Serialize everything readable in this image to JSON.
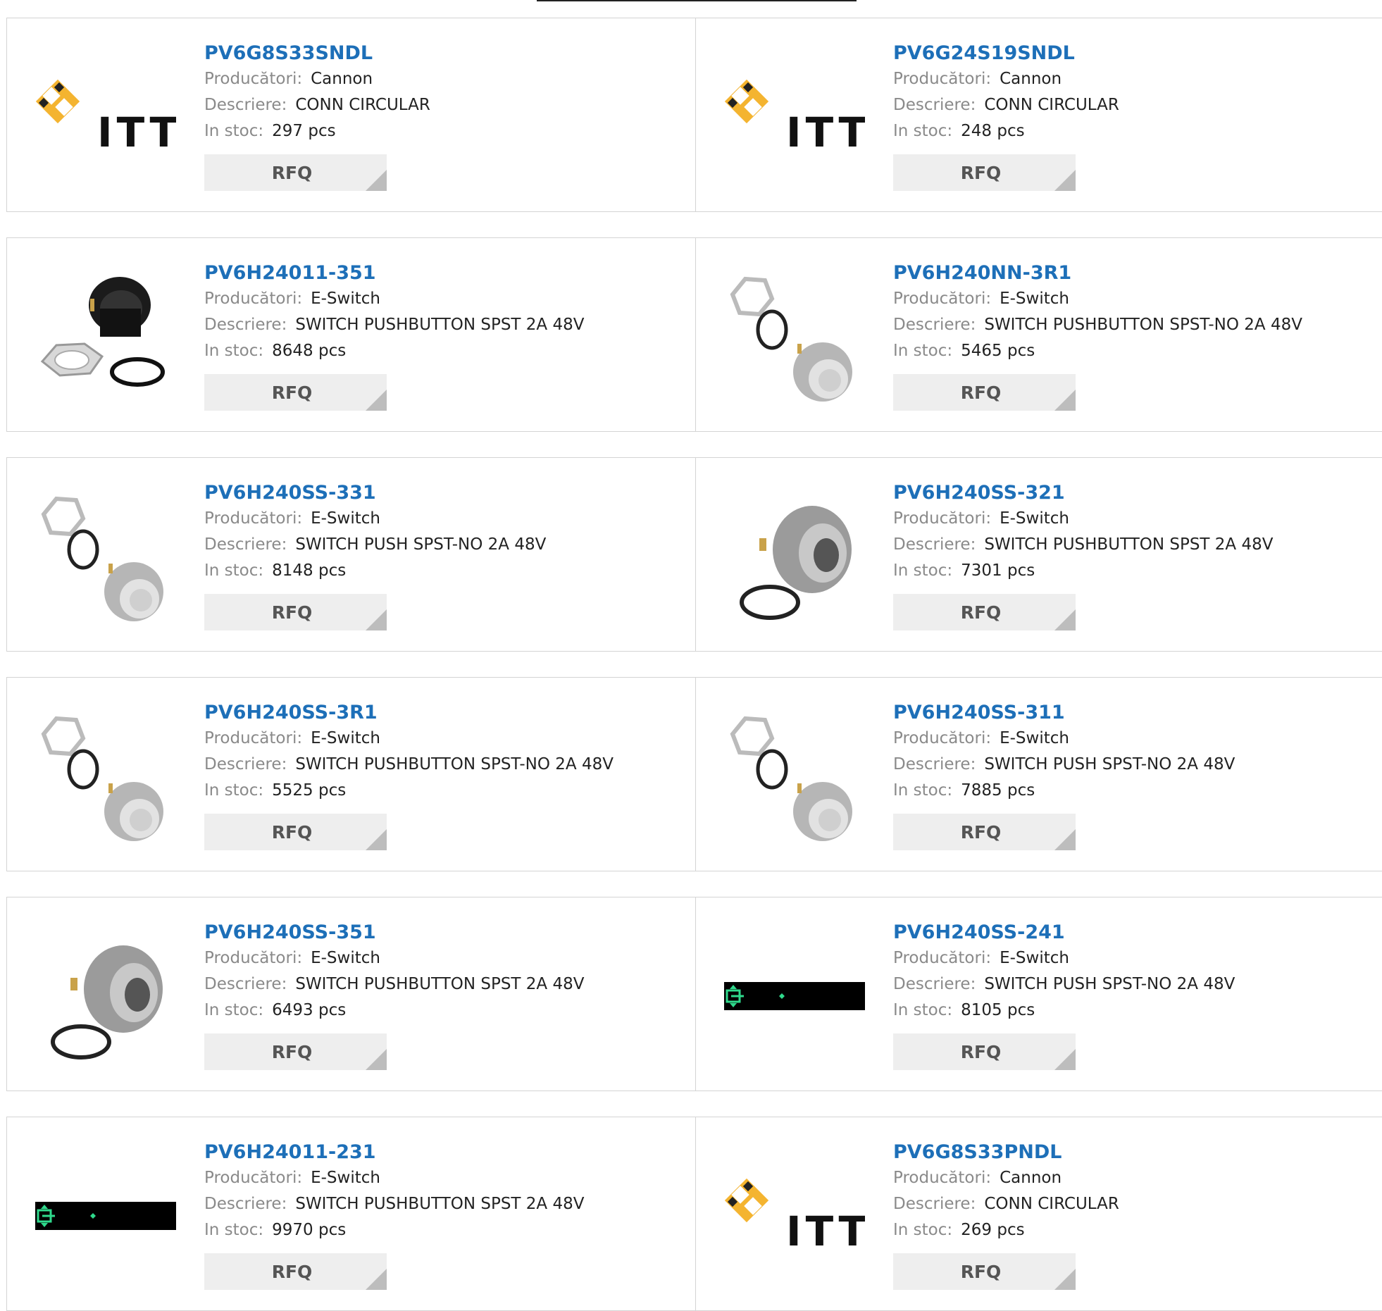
{
  "labels": {
    "manufacturer": "Producători:",
    "description": "Descriere:",
    "stock": "In stoc:",
    "rfq": "RFQ"
  },
  "products": [
    {
      "part": "PV6G8S33SNDL",
      "manufacturer": "Cannon",
      "description": "CONN CIRCULAR",
      "stock": "297 pcs",
      "image": "itt-logo"
    },
    {
      "part": "PV6G24S19SNDL",
      "manufacturer": "Cannon",
      "description": "CONN CIRCULAR",
      "stock": "248 pcs",
      "image": "itt-logo"
    },
    {
      "part": "PV6H24011-351",
      "manufacturer": "E-Switch",
      "description": "SWITCH PUSHBUTTON SPST 2A 48V",
      "stock": "8648 pcs",
      "image": "black-pushbutton"
    },
    {
      "part": "PV6H240NN-3R1",
      "manufacturer": "E-Switch",
      "description": "SWITCH PUSHBUTTON SPST-NO 2A 48V",
      "stock": "5465 pcs",
      "image": "steel-pushbutton-kit"
    },
    {
      "part": "PV6H240SS-331",
      "manufacturer": "E-Switch",
      "description": "SWITCH PUSH SPST-NO 2A 48V",
      "stock": "8148 pcs",
      "image": "steel-pushbutton-kit"
    },
    {
      "part": "PV6H240SS-321",
      "manufacturer": "E-Switch",
      "description": "SWITCH PUSHBUTTON SPST 2A 48V",
      "stock": "7301 pcs",
      "image": "steel-pushbutton"
    },
    {
      "part": "PV6H240SS-3R1",
      "manufacturer": "E-Switch",
      "description": "SWITCH PUSHBUTTON SPST-NO 2A 48V",
      "stock": "5525 pcs",
      "image": "steel-pushbutton-kit"
    },
    {
      "part": "PV6H240SS-311",
      "manufacturer": "E-Switch",
      "description": "SWITCH PUSH SPST-NO 2A 48V",
      "stock": "7885 pcs",
      "image": "steel-pushbutton-kit"
    },
    {
      "part": "PV6H240SS-351",
      "manufacturer": "E-Switch",
      "description": "SWITCH PUSHBUTTON SPST 2A 48V",
      "stock": "6493 pcs",
      "image": "steel-pushbutton"
    },
    {
      "part": "PV6H240SS-241",
      "manufacturer": "E-Switch",
      "description": "SWITCH PUSH SPST-NO 2A 48V",
      "stock": "8105 pcs",
      "image": "placeholder-bar"
    },
    {
      "part": "PV6H24011-231",
      "manufacturer": "E-Switch",
      "description": "SWITCH PUSHBUTTON SPST 2A 48V",
      "stock": "9970 pcs",
      "image": "placeholder-bar"
    },
    {
      "part": "PV6G8S33PNDL",
      "manufacturer": "Cannon",
      "description": "CONN CIRCULAR",
      "stock": "269 pcs",
      "image": "itt-logo"
    }
  ]
}
